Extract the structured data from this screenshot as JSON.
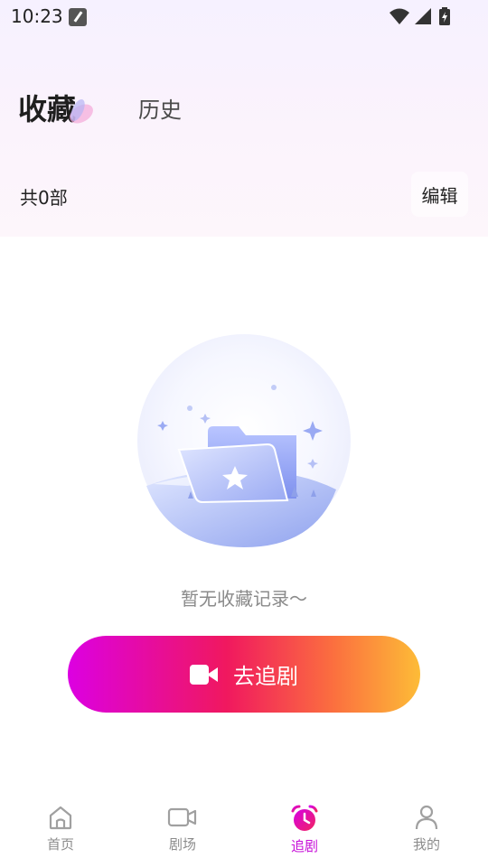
{
  "status_bar": {
    "time": "10:23"
  },
  "tabs": {
    "favorites": "收藏",
    "history": "历史"
  },
  "summary": {
    "count_text": "共0部",
    "edit_label": "编辑"
  },
  "empty_state": {
    "message": "暂无收藏记录～"
  },
  "cta": {
    "label": "去追剧",
    "icon": "video-camera-icon"
  },
  "bottom_nav": {
    "items": [
      {
        "label": "首页",
        "icon": "home-icon",
        "active": false
      },
      {
        "label": "剧场",
        "icon": "video-icon",
        "active": false
      },
      {
        "label": "追剧",
        "icon": "alarm-clock-icon",
        "active": true
      },
      {
        "label": "我的",
        "icon": "user-icon",
        "active": false
      }
    ]
  },
  "colors": {
    "accent": "#c710d8",
    "cta_gradient": [
      "#dc00e2",
      "#f0185f",
      "#fb6e3f",
      "#fdbc37"
    ],
    "inactive": "#8c8c8c"
  }
}
